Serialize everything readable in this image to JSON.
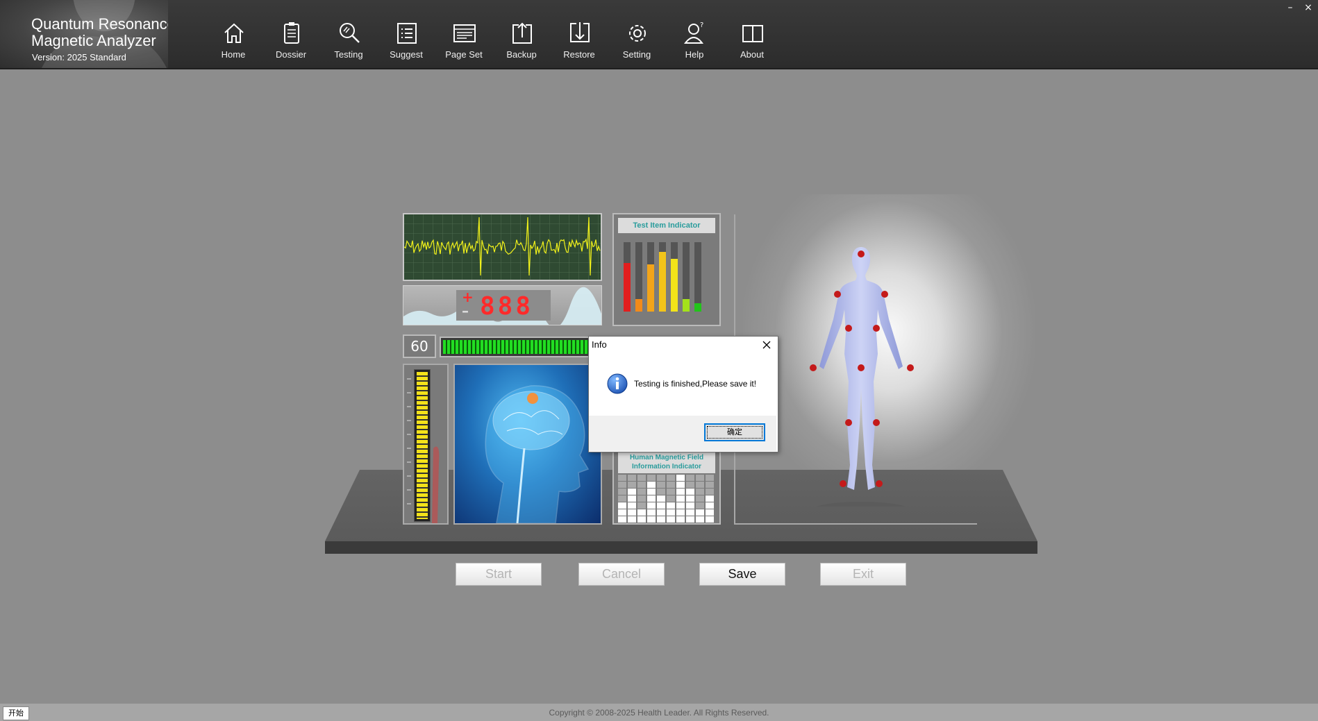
{
  "app": {
    "title_line1": "Quantum Resonance",
    "title_line2": "Magnetic Analyzer",
    "version": "Version: 2025 Standard"
  },
  "nav": [
    {
      "label": "Home",
      "icon": "home-icon"
    },
    {
      "label": "Dossier",
      "icon": "clipboard-icon"
    },
    {
      "label": "Testing",
      "icon": "magnifier-icon"
    },
    {
      "label": "Suggest",
      "icon": "list-icon"
    },
    {
      "label": "Page Set",
      "icon": "page-set-icon"
    },
    {
      "label": "Backup",
      "icon": "backup-icon"
    },
    {
      "label": "Restore",
      "icon": "restore-icon"
    },
    {
      "label": "Setting",
      "icon": "gear-icon"
    },
    {
      "label": "Help",
      "icon": "help-user-icon"
    },
    {
      "label": "About",
      "icon": "book-icon"
    }
  ],
  "window_controls": {
    "minimize": "–",
    "close": "×"
  },
  "instrument": {
    "counter_sign_plus": "+",
    "counter_sign_minus": "–",
    "counter_digits": "888",
    "timer": "60",
    "progress_fraction": 1.0,
    "test_item_indicator": "Test Item Indicator",
    "hmf_line1": "Human Magnetic Field",
    "hmf_line2": "Information Indicator"
  },
  "buttons": {
    "start": "Start",
    "cancel": "Cancel",
    "save": "Save",
    "exit": "Exit"
  },
  "dialog": {
    "title": "Info",
    "message": "Testing is finished,Please save it!",
    "ok": "确定"
  },
  "footer": {
    "copyright": "Copyright © 2008-2025 Health Leader. All Rights Reserved.",
    "start_menu": "开始"
  },
  "colors": {
    "accent_red": "#ff2a2a",
    "progress_green": "#22dd22",
    "indicator_teal": "#2a9c9c",
    "dialog_focus": "#0078d7"
  }
}
